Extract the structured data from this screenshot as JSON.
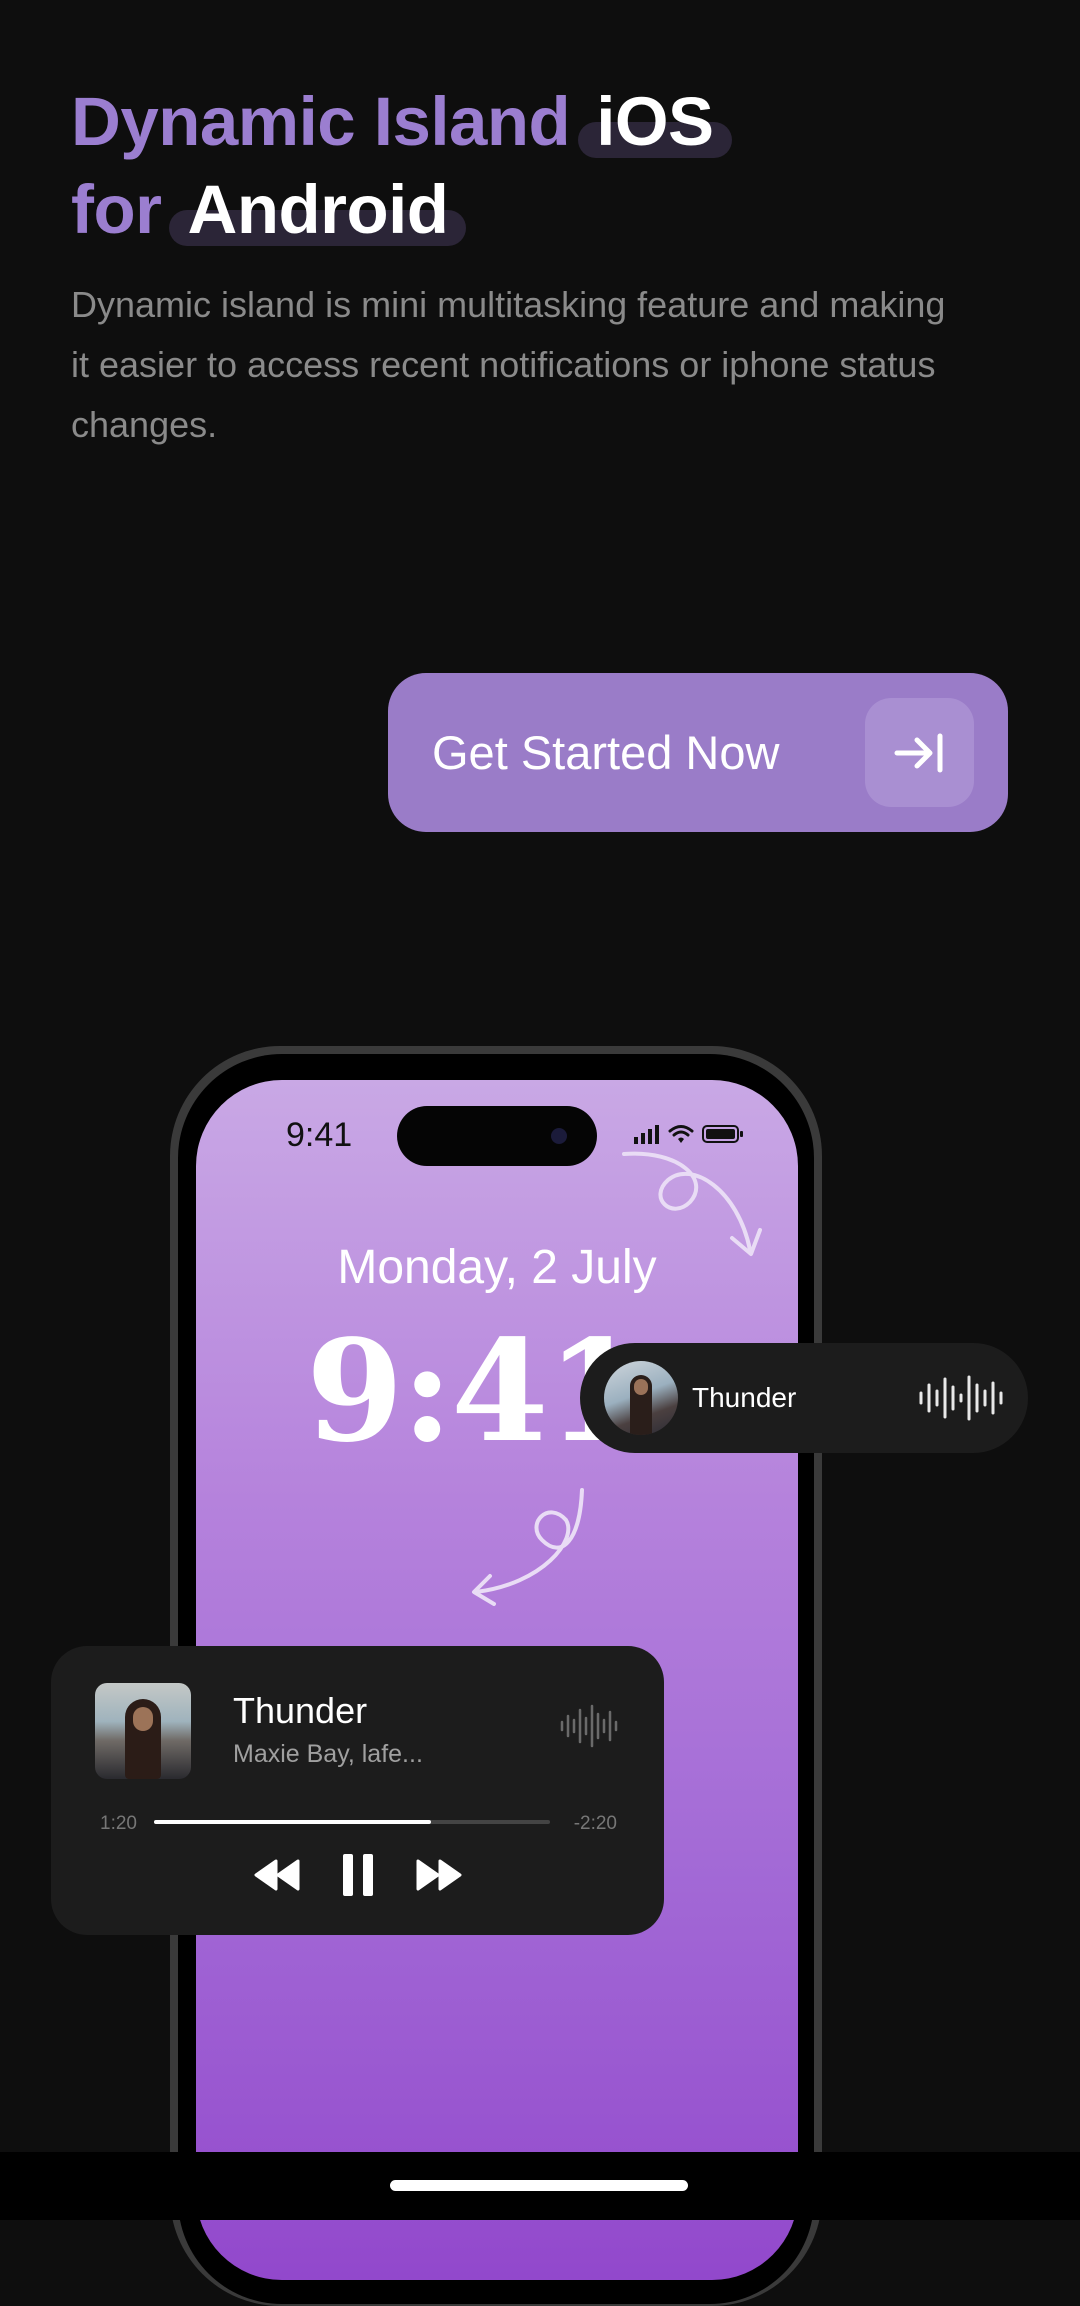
{
  "hero": {
    "title_part1": "Dynamic Island",
    "title_pill1": "iOS",
    "title_part2": "for",
    "title_pill2": "Android",
    "subtitle": "Dynamic island is mini multitasking feature and making it easier to access recent notifications or iphone status changes."
  },
  "cta": {
    "label": "Get Started Now",
    "icon": "arrow-right-to-bar-icon"
  },
  "phone": {
    "status_time": "9:41",
    "lock_date": "Monday, 2 July",
    "lock_time": "9:41"
  },
  "island_notification": {
    "title": "Thunder",
    "icon": "audio-wave-icon"
  },
  "music_player": {
    "title": "Thunder",
    "artist": "Maxie Bay, lafe...",
    "elapsed": "1:20",
    "remaining": "-2:20",
    "progress": 0.7
  },
  "colors": {
    "accent": "#9a7cc8",
    "background": "#0e0e0e",
    "card": "#1c1c1c"
  }
}
